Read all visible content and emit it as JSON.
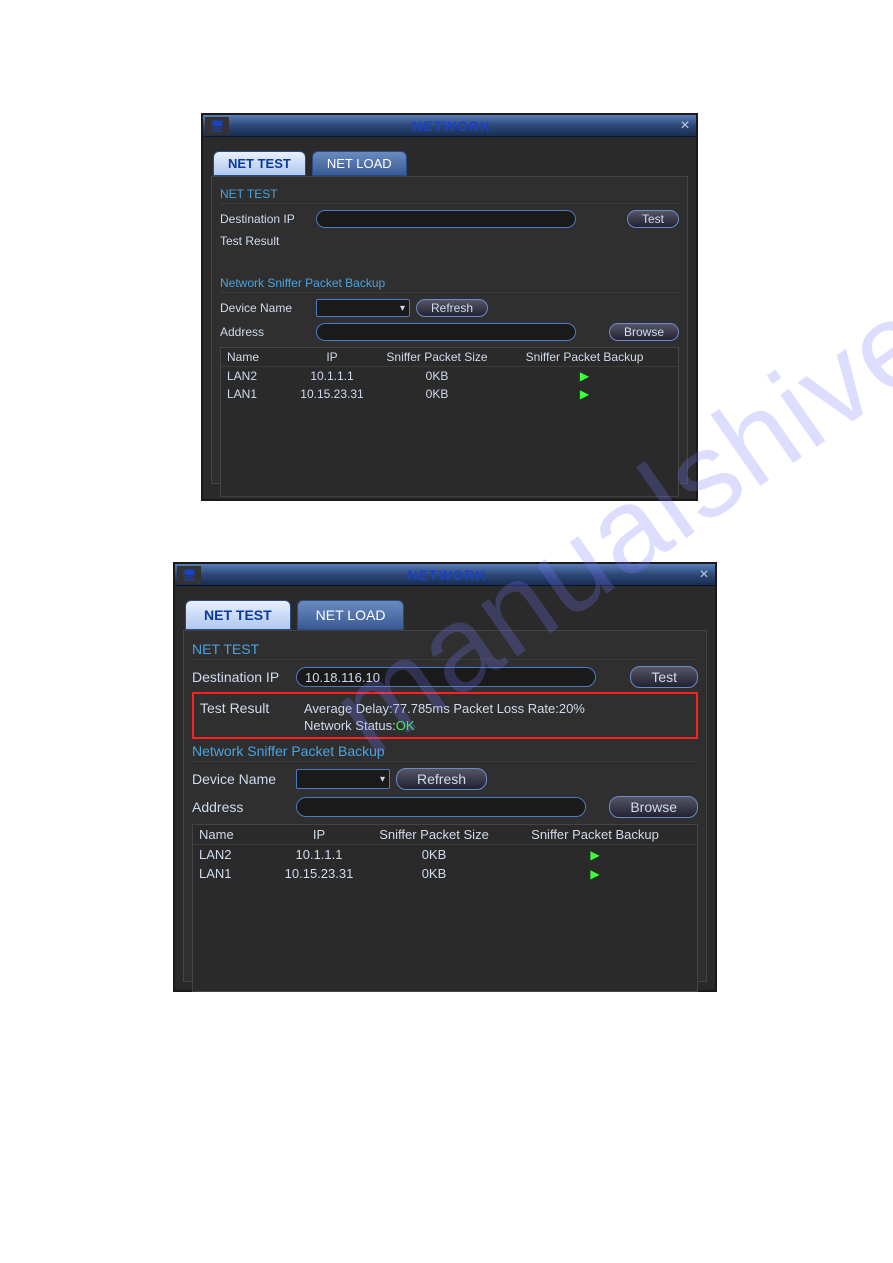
{
  "watermark": "manualshive.com",
  "dialog1": {
    "title": "NETWORK",
    "tabs": {
      "net_test": "NET TEST",
      "net_load": "NET LOAD"
    },
    "section_net_test": "NET TEST",
    "dest_ip_label": "Destination IP",
    "dest_ip_value": "",
    "test_btn": "Test",
    "test_result_label": "Test Result",
    "section_sniffer": "Network Sniffer Packet Backup",
    "device_name_label": "Device Name",
    "device_name_value": "",
    "refresh_btn": "Refresh",
    "address_label": "Address",
    "address_value": "",
    "browse_btn": "Browse",
    "cols": {
      "name": "Name",
      "ip": "IP",
      "size": "Sniffer Packet Size",
      "backup": "Sniffer Packet Backup"
    },
    "rows": [
      {
        "name": "LAN2",
        "ip": "10.1.1.1",
        "size": "0KB"
      },
      {
        "name": "LAN1",
        "ip": "10.15.23.31",
        "size": "0KB"
      }
    ]
  },
  "dialog2": {
    "title": "NETWORK",
    "tabs": {
      "net_test": "NET TEST",
      "net_load": "NET LOAD"
    },
    "section_net_test": "NET TEST",
    "dest_ip_label": "Destination IP",
    "dest_ip_value": "10.18.116.10",
    "test_btn": "Test",
    "test_result_label": "Test Result",
    "result_line1": "Average Delay:77.785ms  Packet Loss Rate:20%",
    "result_status_lbl": "Network Status:",
    "result_status_val": "OK",
    "section_sniffer": "Network Sniffer Packet Backup",
    "device_name_label": "Device Name",
    "device_name_value": "",
    "refresh_btn": "Refresh",
    "address_label": "Address",
    "address_value": "",
    "browse_btn": "Browse",
    "cols": {
      "name": "Name",
      "ip": "IP",
      "size": "Sniffer Packet Size",
      "backup": "Sniffer Packet Backup"
    },
    "rows": [
      {
        "name": "LAN2",
        "ip": "10.1.1.1",
        "size": "0KB"
      },
      {
        "name": "LAN1",
        "ip": "10.15.23.31",
        "size": "0KB"
      }
    ]
  }
}
